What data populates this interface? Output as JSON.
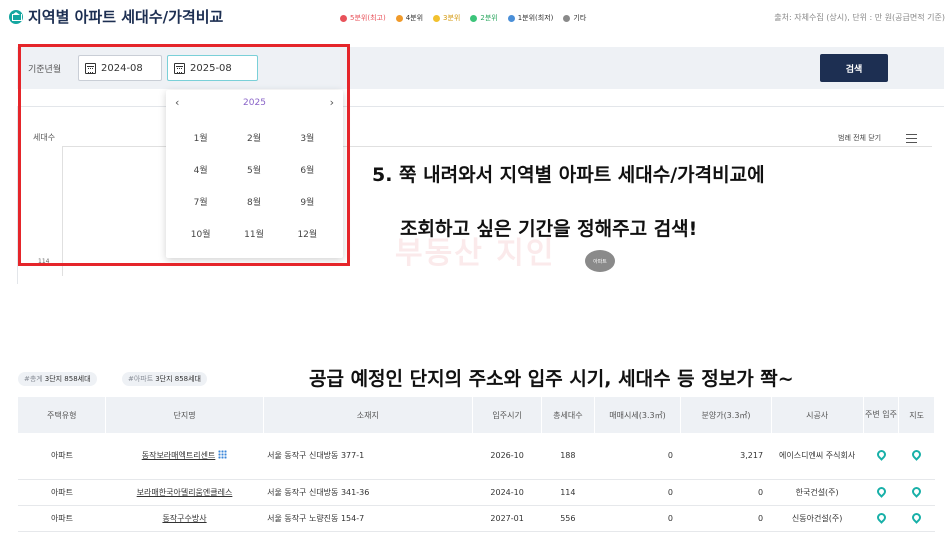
{
  "header": {
    "title": "지역별 아파트 세대수/가격비교",
    "source": "출처: 자체수집 (상시), 단위 : 만 원(공급면적 기준)",
    "legend": [
      {
        "label": "5분위(최고)",
        "color": "#e8525a"
      },
      {
        "label": "4분위",
        "color": "#f09a2a"
      },
      {
        "label": "3분위",
        "color": "#f2c12e"
      },
      {
        "label": "2분위",
        "color": "#3cc47a"
      },
      {
        "label": "1분위(최저)",
        "color": "#4a8fd8"
      },
      {
        "label": "기타",
        "color": "#8a8a8a"
      }
    ]
  },
  "search": {
    "base_label": "기준년월",
    "start_value": "2024-08",
    "end_value": "2025-08",
    "button_label": "검색"
  },
  "picker": {
    "prev": "‹",
    "next": "›",
    "year": "2025",
    "months": [
      "1월",
      "2월",
      "3월",
      "4월",
      "5월",
      "6월",
      "7월",
      "8월",
      "9월",
      "10월",
      "11월",
      "12월"
    ]
  },
  "chart": {
    "ylabel": "세대수",
    "tick": "114",
    "close_all": "범례 전체 닫기",
    "watermark": "부동산 지인",
    "watermark_badge": "아파트"
  },
  "captions": {
    "line1": "5. 쭉 내려와서 지역별 아파트 세대수/가격비교에",
    "line2": "조회하고 싶은 기간을 정해주고 검색!",
    "line3": "공급 예정인 단지의 주소와 입주 시기, 세대수 등 정보가 쫙~"
  },
  "badges": {
    "total_prefix": "#총계",
    "total_value": "3단지 858세대",
    "apt_prefix": "#아파트",
    "apt_value": "3단지 858세대"
  },
  "table": {
    "headers": [
      "주택유형",
      "단지명",
      "소재지",
      "입주시기",
      "총세대수",
      "매매시세(3.3㎡)",
      "분양가(3.3㎡)",
      "시공사",
      "주변 입주",
      "지도"
    ],
    "rows": [
      {
        "type": "아파트",
        "name": "동작보라매엑트리센트",
        "address": "서울 동작구 신대방동 377-1",
        "move_in": "2026-10",
        "units": "188",
        "sale": "0",
        "presale": "3,217",
        "builder": "에이스디엔씨 주식회사"
      },
      {
        "type": "아파트",
        "name": "보라매한국아델리움엔클레스",
        "address": "서울 동작구 신대방동 341-36",
        "move_in": "2024-10",
        "units": "114",
        "sale": "0",
        "presale": "0",
        "builder": "한국건설(주)"
      },
      {
        "type": "아파트",
        "name": "동작구수방사",
        "address": "서울 동작구 노량진동 154-7",
        "move_in": "2027-01",
        "units": "556",
        "sale": "0",
        "presale": "0",
        "builder": "신동아건설(주)"
      }
    ]
  }
}
